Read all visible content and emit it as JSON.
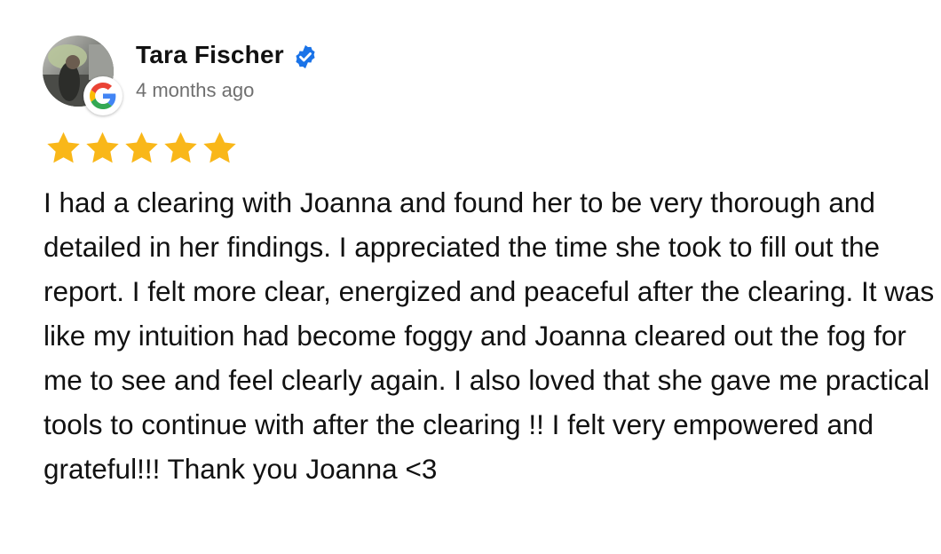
{
  "review": {
    "author_name": "Tara Fischer",
    "date": "4 months ago",
    "rating": 5,
    "rating_max": 5,
    "text": "I had a clearing with Joanna and found her to be very thorough and detailed in her findings. I appreciated the time she took to fill out the report. I felt more clear, energized and peaceful after the clearing. It was like my intuition had become foggy and Joanna cleared out the fog for me to see and feel clearly again. I also loved that she gave me practical tools to continue with after the clearing !! I felt very empowered and grateful!!! Thank you Joanna <3"
  },
  "icons": {
    "avatar": "profile-photo",
    "source_badge": "google-g-icon",
    "verified": "verified-check-icon",
    "star": "star-icon"
  },
  "colors": {
    "star": "#F9B719",
    "verified": "#1A73E8",
    "date_text": "#6F6F6F",
    "google_blue": "#4285F4",
    "google_red": "#EA4335",
    "google_yellow": "#FBBC05",
    "google_green": "#34A853"
  }
}
